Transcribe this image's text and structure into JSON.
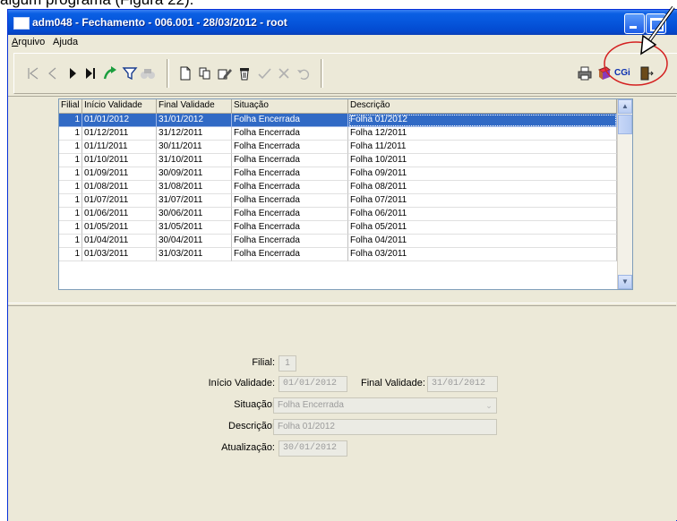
{
  "doc_caption": "algum programa (Figura 22).",
  "window": {
    "title": "adm048 - Fechamento - 006.001 - 28/03/2012 - root"
  },
  "menu": [
    {
      "label": "Arquivo",
      "underline": "A",
      "rest": "rquivo"
    },
    {
      "label": "Ajuda",
      "underline": "",
      "rest": "Ajuda"
    }
  ],
  "toolbar": {
    "nav_icons": [
      "first-record-icon",
      "previous-record-icon",
      "next-record-icon",
      "last-record-icon",
      "goto-icon",
      "filter-icon",
      "search-binoculars-icon"
    ],
    "edit_icons": [
      "new-document-icon",
      "copy-icon",
      "edit-pencil-icon",
      "delete-trash-icon",
      "confirm-check-icon",
      "cancel-x-icon",
      "undo-icon"
    ],
    "right_icons": [
      "print-icon",
      "help-book-icon",
      "cgi-icon",
      "exit-door-icon"
    ],
    "cgi_label": "CGi"
  },
  "grid": {
    "columns": [
      "Filial",
      "Início Validade",
      "Final Validade",
      "Situação",
      "Descrição"
    ],
    "rows": [
      {
        "filial": "1",
        "inicio": "01/01/2012",
        "final": "31/01/2012",
        "situacao": "Folha Encerrada",
        "descricao": "Folha 01/2012"
      },
      {
        "filial": "1",
        "inicio": "01/12/2011",
        "final": "31/12/2011",
        "situacao": "Folha Encerrada",
        "descricao": "Folha 12/2011"
      },
      {
        "filial": "1",
        "inicio": "01/11/2011",
        "final": "30/11/2011",
        "situacao": "Folha Encerrada",
        "descricao": "Folha 11/2011"
      },
      {
        "filial": "1",
        "inicio": "01/10/2011",
        "final": "31/10/2011",
        "situacao": "Folha Encerrada",
        "descricao": "Folha 10/2011"
      },
      {
        "filial": "1",
        "inicio": "01/09/2011",
        "final": "30/09/2011",
        "situacao": "Folha Encerrada",
        "descricao": "Folha 09/2011"
      },
      {
        "filial": "1",
        "inicio": "01/08/2011",
        "final": "31/08/2011",
        "situacao": "Folha Encerrada",
        "descricao": "Folha 08/2011"
      },
      {
        "filial": "1",
        "inicio": "01/07/2011",
        "final": "31/07/2011",
        "situacao": "Folha Encerrada",
        "descricao": "Folha 07/2011"
      },
      {
        "filial": "1",
        "inicio": "01/06/2011",
        "final": "30/06/2011",
        "situacao": "Folha Encerrada",
        "descricao": "Folha 06/2011"
      },
      {
        "filial": "1",
        "inicio": "01/05/2011",
        "final": "31/05/2011",
        "situacao": "Folha Encerrada",
        "descricao": "Folha 05/2011"
      },
      {
        "filial": "1",
        "inicio": "01/04/2011",
        "final": "30/04/2011",
        "situacao": "Folha Encerrada",
        "descricao": "Folha 04/2011"
      },
      {
        "filial": "1",
        "inicio": "01/03/2011",
        "final": "31/03/2011",
        "situacao": "Folha Encerrada",
        "descricao": "Folha 03/2011"
      }
    ]
  },
  "form": {
    "filial_label": "Filial:",
    "filial_value": "1",
    "inicio_label": "Início Validade:",
    "inicio_value": "01/01/2012",
    "final_label": "Final Validade:",
    "final_value": "31/01/2012",
    "situacao_label": "Situação:",
    "situacao_value": "Folha Encerrada",
    "descricao_label": "Descrição:",
    "descricao_value": "Folha 01/2012",
    "atualizacao_label": "Atualização:",
    "atualizacao_value": "30/01/2012"
  },
  "colors": {
    "selection": "#316ac5",
    "titlebar": "#0656dc",
    "annotation": "#d42020"
  }
}
